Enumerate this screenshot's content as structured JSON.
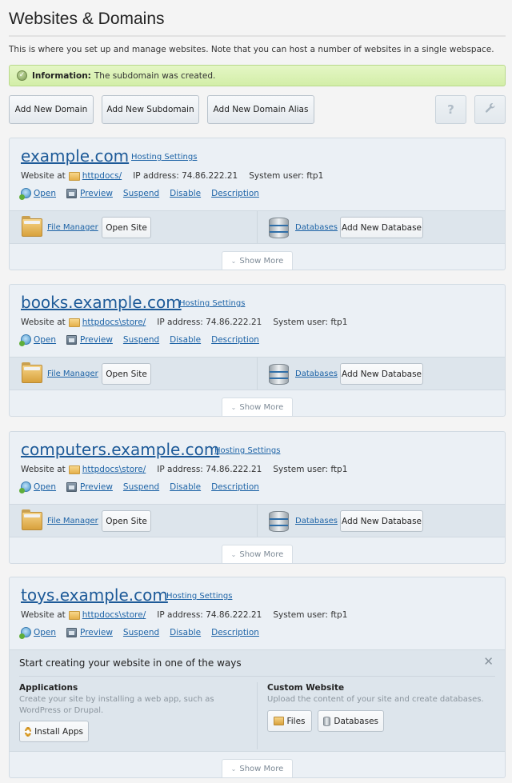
{
  "page": {
    "title": "Websites & Domains",
    "intro": "This is where you set up and manage websites. Note that you can host a number of websites in a single webspace.",
    "info": {
      "label": "Information:",
      "message": "The subdomain was created."
    }
  },
  "toolbar": {
    "add_domain": "Add New Domain",
    "add_subdomain": "Add New Subdomain",
    "add_alias": "Add New Domain Alias",
    "help": "?",
    "tools": "🔧"
  },
  "common": {
    "hosting_settings": "Hosting Settings",
    "website_at": "Website at",
    "ip_label": "IP address:",
    "user_label": "System user:",
    "actions": [
      "Open",
      "Preview",
      "Suspend",
      "Disable",
      "Description"
    ],
    "file_manager": "File Manager",
    "open_site": "Open Site",
    "databases": "Databases",
    "add_database": "Add New Database",
    "show_more": "Show More",
    "chevron": "⌄"
  },
  "domains": [
    {
      "name": "example.com",
      "path": "httpdocs/",
      "ip": "74.86.222.21",
      "user": "ftp1"
    },
    {
      "name": "books.example.com",
      "path": "httpdocs\\store/",
      "ip": "74.86.222.21",
      "user": "ftp1"
    },
    {
      "name": "computers.example.com",
      "path": "httpdocs\\store/",
      "ip": "74.86.222.21",
      "user": "ftp1"
    },
    {
      "name": "toys.example.com",
      "path": "httpdocs\\store/",
      "ip": "74.86.222.21",
      "user": "ftp1"
    }
  ],
  "start_panel": {
    "title": "Start creating your website in one of the ways",
    "close": "✕",
    "applications": {
      "title": "Applications",
      "desc": "Create your site by installing a web app, such as WordPress or Drupal.",
      "button": "Install Apps"
    },
    "custom": {
      "title": "Custom Website",
      "desc": "Upload the content of your site and create databases.",
      "files_button": "Files",
      "databases_button": "Databases"
    }
  }
}
